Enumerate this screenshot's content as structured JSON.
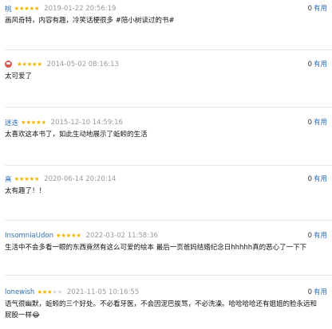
{
  "useful_label": "有用",
  "reviews": [
    {
      "user": "桃",
      "rating": 5,
      "time": "2019-01-22 20:56:19",
      "useful": "0",
      "content": "画风奇特，内容有趣，冷笑话梗很多 #陪小树读过的书#"
    },
    {
      "user": "",
      "avatar": "red-avatar-icon",
      "rating": 5,
      "time": "2014-05-02 08:16:13",
      "useful": "0",
      "content": "太可爱了"
    },
    {
      "user": "迷迭",
      "rating": 5,
      "time": "2015-12-10 14:59:16",
      "useful": "0",
      "content": "太喜欢这本书了，如此生动地展示了蚯蚓的生活"
    },
    {
      "user": "熹",
      "rating": 5,
      "time": "2020-06-14 20:20:14",
      "useful": "0",
      "content": "太有趣了！！"
    },
    {
      "user": "InsomniaUdon",
      "rating": 5,
      "time": "2022-03-02 11:58:36",
      "useful": "0",
      "content": "生活中不会多看一眼的东西竟然有这么可爱的绘本 最后一页爸妈结婚纪念日hhhhh真的恶心了一下下"
    },
    {
      "user": "lonewish",
      "rating": 3,
      "time": "2021-11-05 10:16:55",
      "useful": "0",
      "content": "语气很幽默，蚯蚓的三个好处。不必看牙医，不会因泥巴挨骂，不必洗澡。哈哈哈哈还有姐姐的脸永远和屁股一样😂"
    }
  ],
  "colors": {
    "star": "#f4b400",
    "star_empty": "#d7d7d7",
    "link": "#2f6fb5"
  }
}
